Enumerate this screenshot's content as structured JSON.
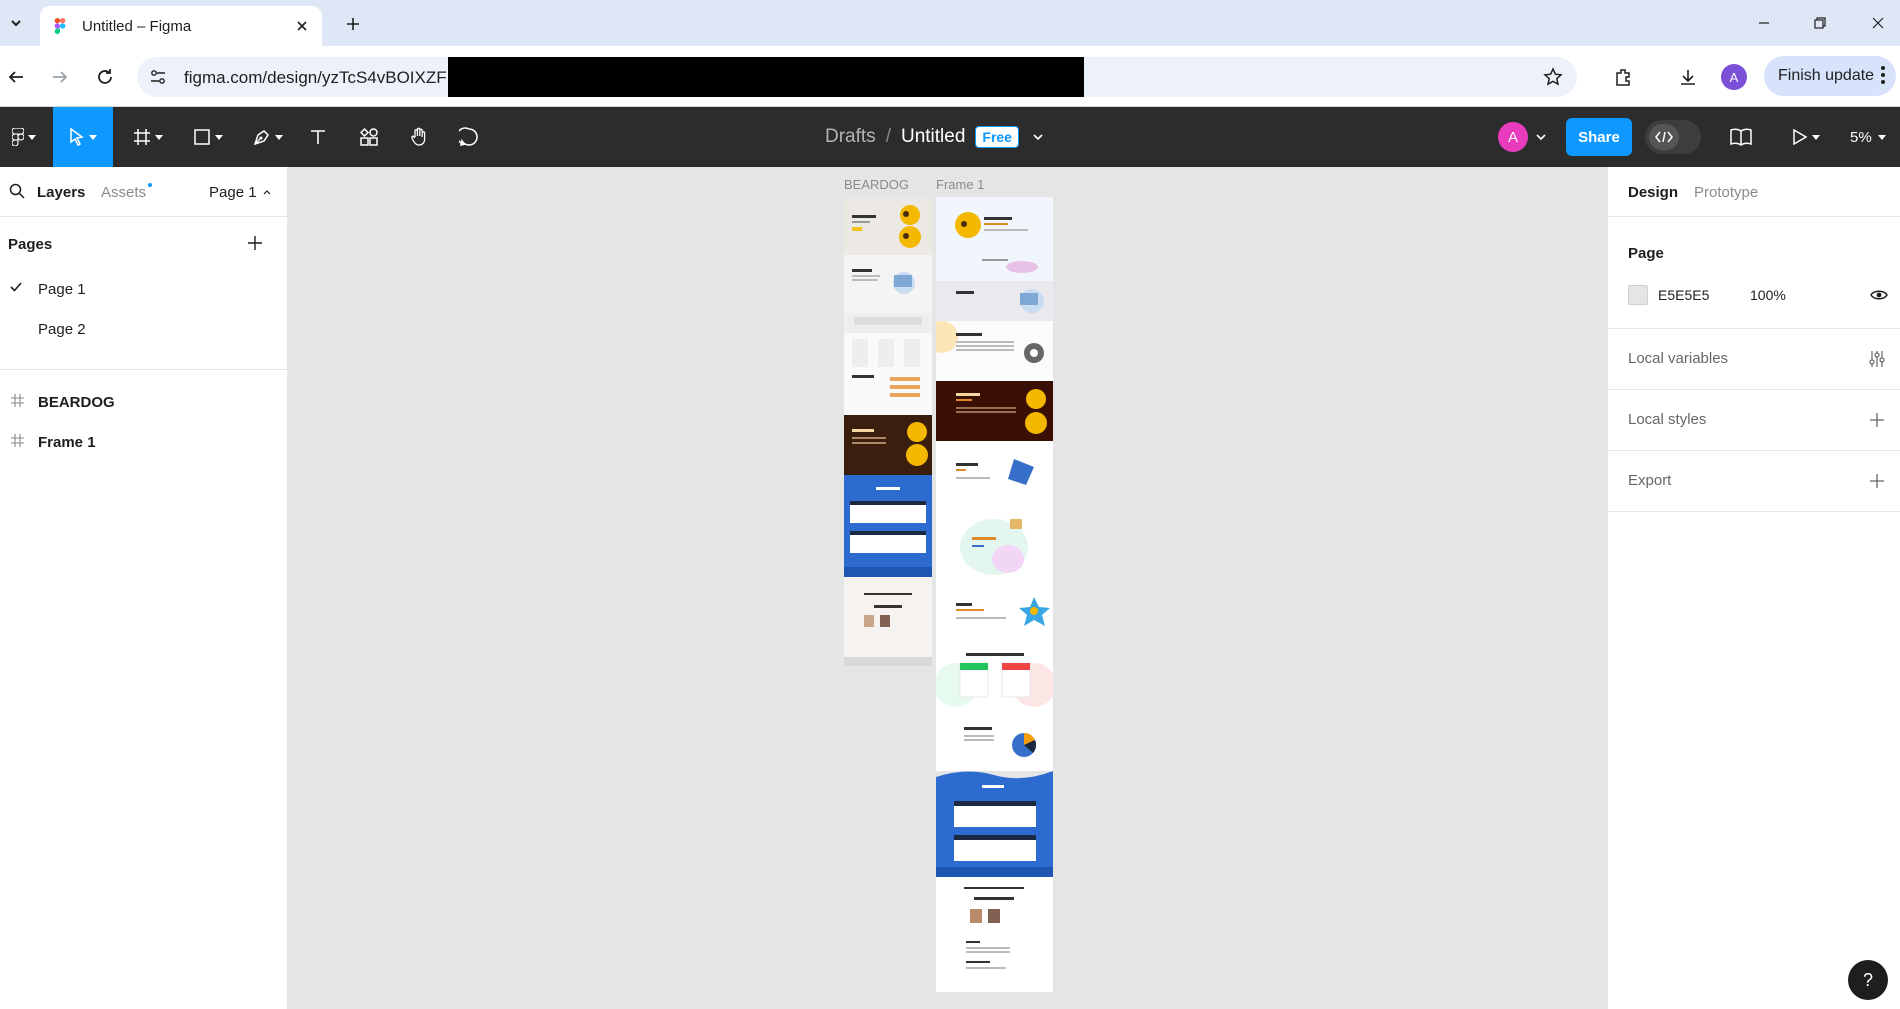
{
  "browser": {
    "tab_title": "Untitled – Figma",
    "url": "figma.com/design/yzTcS4vBOIXZF",
    "finish_update_label": "Finish update",
    "profile_initial": "A"
  },
  "toolbar": {
    "breadcrumb_parent": "Drafts",
    "breadcrumb_separator": "/",
    "file_name": "Untitled",
    "plan_badge": "Free",
    "user_initial": "A",
    "share_label": "Share",
    "zoom_level": "5%"
  },
  "left_panel": {
    "tabs": {
      "layers": "Layers",
      "assets": "Assets"
    },
    "current_page": "Page 1",
    "pages_title": "Pages",
    "pages": [
      {
        "label": "Page 1",
        "selected": true
      },
      {
        "label": "Page 2",
        "selected": false
      }
    ],
    "layers": [
      {
        "label": "BEARDOG",
        "type": "frame"
      },
      {
        "label": "Frame 1",
        "type": "frame"
      }
    ]
  },
  "canvas": {
    "frames": [
      {
        "title": "BEARDOG"
      },
      {
        "title": "Frame 1"
      }
    ]
  },
  "right_panel": {
    "tabs": {
      "design": "Design",
      "prototype": "Prototype"
    },
    "page_section_title": "Page",
    "background_hex": "E5E5E5",
    "background_opacity": "100%",
    "local_variables": "Local variables",
    "local_styles": "Local styles",
    "export": "Export"
  },
  "help_label": "?",
  "colors": {
    "accent": "#0d99ff",
    "toolbar_bg": "#2c2c2c",
    "canvas_bg": "#e5e5e5",
    "user_avatar": "#e93bbd"
  }
}
